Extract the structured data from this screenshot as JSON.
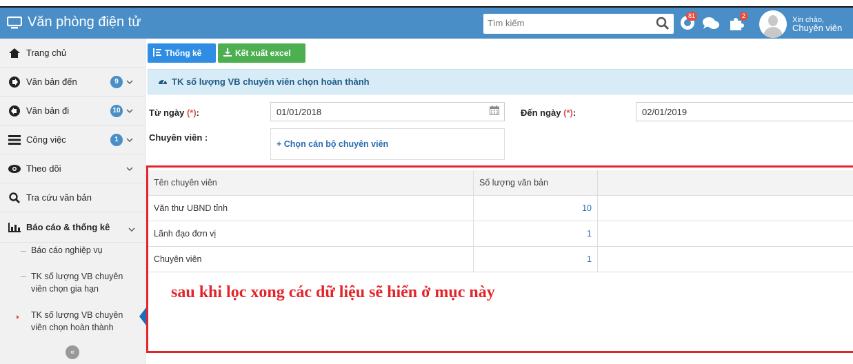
{
  "header": {
    "title": "Văn phòng điện tử",
    "search_placeholder": "Tìm kiếm",
    "badges": {
      "notifications": "81",
      "extensions": "2"
    },
    "greeting": "Xin chào,",
    "user_name": "Chuyên viên"
  },
  "sidebar": {
    "items": [
      {
        "label": "Trang chủ",
        "icon": "home-icon"
      },
      {
        "label": "Văn bản đến",
        "count": "9",
        "icon": "arrow-right-circle-icon"
      },
      {
        "label": "Văn bản đi",
        "count": "10",
        "icon": "arrow-left-circle-icon"
      },
      {
        "label": "Công việc",
        "count": "1",
        "icon": "tasks-icon"
      },
      {
        "label": "Theo dõi",
        "icon": "eye-icon"
      },
      {
        "label": "Tra cứu văn bản",
        "icon": "search-icon"
      },
      {
        "label": "Báo cáo & thống kê",
        "icon": "bar-chart-icon"
      }
    ],
    "subitems": [
      {
        "label": "Báo cáo nghiệp vụ"
      },
      {
        "label": "TK số lượng VB chuyên viên chọn gia hạn"
      },
      {
        "label": "TK số lượng VB chuyên viên chọn hoàn thành"
      }
    ]
  },
  "toolbar": {
    "stats_label": "Thống kê",
    "export_label": "Kết xuất excel"
  },
  "panel": {
    "title": "TK số lượng VB chuyên viên chọn hoàn thành"
  },
  "filters": {
    "from_label": "Từ ngày",
    "from_value": "01/01/2018",
    "to_label": "Đến ngày",
    "to_value": "02/01/2019",
    "required_mark": "(*)",
    "colon": ":",
    "staff_label": "Chuyên viên :",
    "staff_picker": "+ Chọn cán bộ chuyên viên"
  },
  "table": {
    "headers": [
      "Tên chuyên viên",
      "Số lượng văn bản"
    ],
    "rows": [
      [
        "Văn thư UBND tỉnh",
        "10"
      ],
      [
        "Lãnh đạo đơn vị",
        "1"
      ],
      [
        "Chuyên viên",
        "1"
      ]
    ]
  },
  "annotation": "sau khi lọc xong các dữ liệu sẽ hiển ở mục này",
  "colors": {
    "topbar": "#4a8ec8",
    "highlight": "#e3242b"
  }
}
